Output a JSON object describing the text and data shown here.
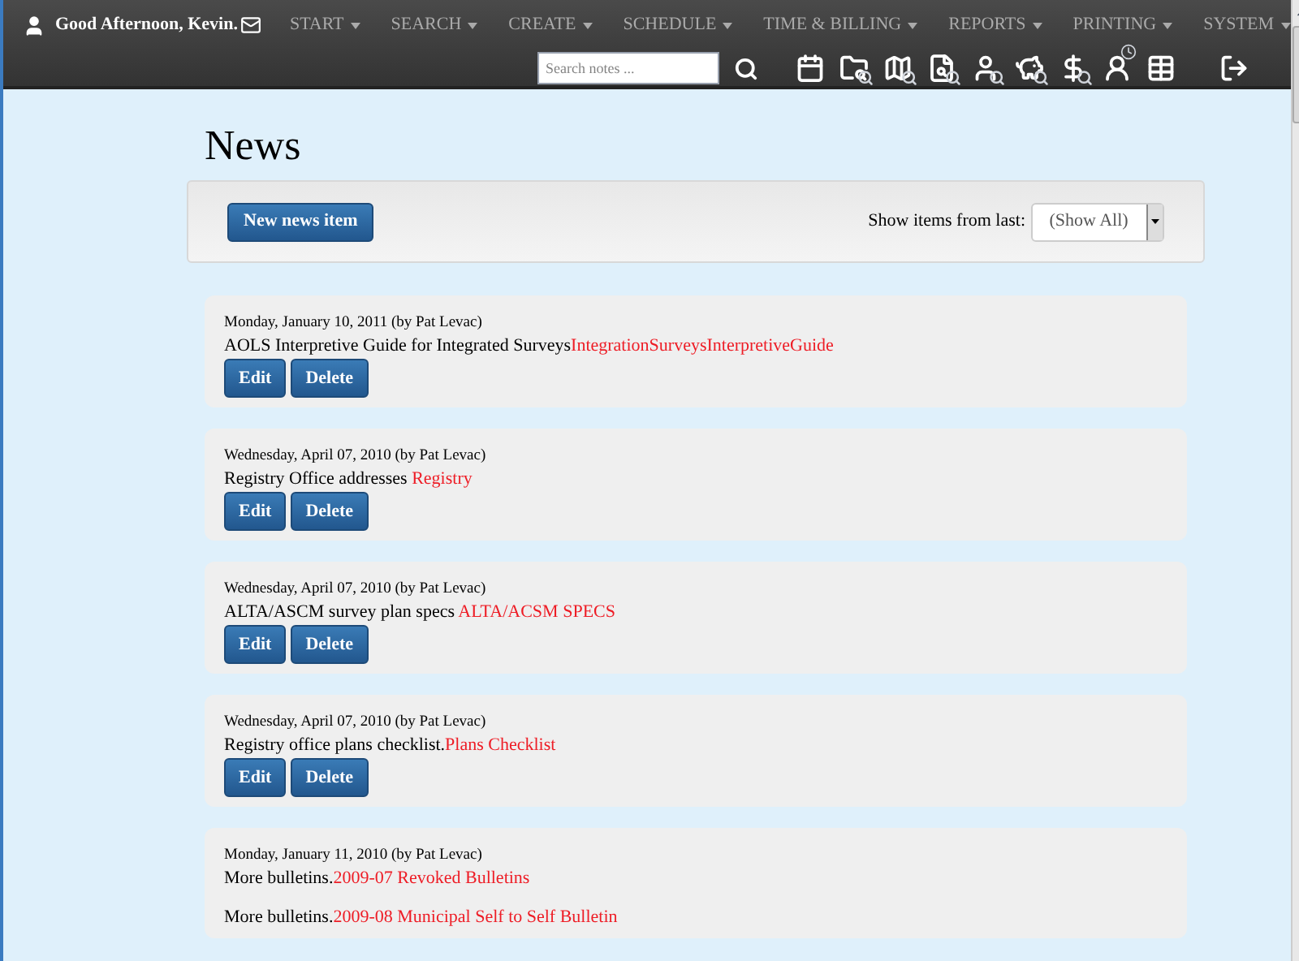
{
  "greeting": "Good Afternoon, Kevin.",
  "menu": [
    {
      "label": "START"
    },
    {
      "label": "SEARCH"
    },
    {
      "label": "CREATE"
    },
    {
      "label": "SCHEDULE"
    },
    {
      "label": "TIME & BILLING"
    },
    {
      "label": "REPORTS"
    },
    {
      "label": "PRINTING"
    },
    {
      "label": "SYSTEM"
    }
  ],
  "search": {
    "placeholder": "Search notes ..."
  },
  "toolbar": [
    {
      "kind": "calendar"
    },
    {
      "kind": "folder-search"
    },
    {
      "kind": "map-search"
    },
    {
      "kind": "file-search"
    },
    {
      "kind": "user-search"
    },
    {
      "kind": "piggy-search"
    },
    {
      "kind": "dollar-search"
    },
    {
      "kind": "user-clock"
    },
    {
      "kind": "list"
    },
    {
      "kind": "logout"
    }
  ],
  "title": "News",
  "new_button": "New news item",
  "filter": {
    "label": "Show items from last:",
    "value": "(Show All)"
  },
  "items": [
    {
      "meta": "Monday, January 10, 2011 (by Pat Levac)",
      "lines": [
        {
          "text": "AOLS Interpretive Guide for Integrated Surveys",
          "link": "IntegrationSurveysInterpretiveGuide"
        }
      ],
      "buttons": [
        "Edit",
        "Delete"
      ]
    },
    {
      "meta": "Wednesday, April 07, 2010 (by Pat Levac)",
      "lines": [
        {
          "text": "Registry Office addresses ",
          "link": "Registry"
        }
      ],
      "buttons": [
        "Edit",
        "Delete"
      ]
    },
    {
      "meta": "Wednesday, April 07, 2010 (by Pat Levac)",
      "lines": [
        {
          "text": "ALTA/ASCM survey plan specs ",
          "link": "ALTA/ACSM SPECS"
        }
      ],
      "buttons": [
        "Edit",
        "Delete"
      ]
    },
    {
      "meta": "Wednesday, April 07, 2010 (by Pat Levac)",
      "lines": [
        {
          "text": "Registry office plans checklist.",
          "link": "Plans Checklist"
        }
      ],
      "buttons": [
        "Edit",
        "Delete"
      ]
    },
    {
      "meta": "Monday, January 11, 2010 (by Pat Levac)",
      "lines": [
        {
          "text": "More bulletins.",
          "link": "2009-07 Revoked Bulletins"
        },
        {
          "text": "More bulletins.",
          "link": "2009-08 Municipal Self to Self Bulletin"
        }
      ]
    }
  ]
}
